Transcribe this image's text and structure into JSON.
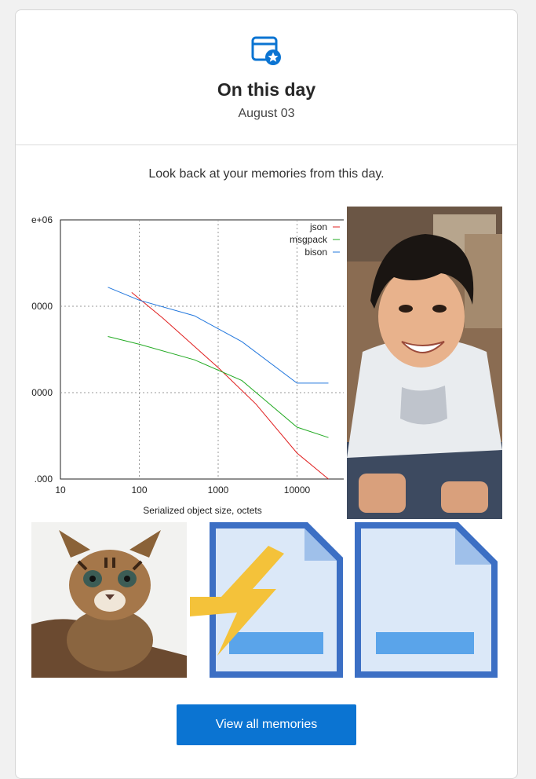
{
  "header": {
    "icon": "calendar-star-icon",
    "accent_color": "#0b74d2",
    "title": "On this day",
    "date": "August 03"
  },
  "intro_text": "Look back at your memories from this day.",
  "memories": [
    {
      "type": "chart",
      "chart_data": {
        "type": "line",
        "xscale": "log",
        "yscale": "log",
        "xlabel": "Serialized object size, octets",
        "x_ticks": [
          "10",
          "100",
          "1000",
          "10000"
        ],
        "y_ticks": [
          ".000",
          "0000",
          "0000",
          "e+06"
        ],
        "grid": true,
        "legend_position": "top-right",
        "series": [
          {
            "name": "json",
            "color": "#e02020",
            "points": [
              [
                80,
                0.72
              ],
              [
                200,
                0.62
              ],
              [
                1000,
                0.43
              ],
              [
                3000,
                0.29
              ],
              [
                10000,
                0.1
              ],
              [
                25000,
                0.0
              ]
            ]
          },
          {
            "name": "msgpack",
            "color": "#22aa22",
            "points": [
              [
                40,
                0.55
              ],
              [
                100,
                0.52
              ],
              [
                500,
                0.46
              ],
              [
                2000,
                0.38
              ],
              [
                10000,
                0.2
              ],
              [
                25000,
                0.16
              ]
            ]
          },
          {
            "name": "bison",
            "color": "#2277dd",
            "points": [
              [
                40,
                0.74
              ],
              [
                100,
                0.69
              ],
              [
                500,
                0.63
              ],
              [
                2000,
                0.53
              ],
              [
                10000,
                0.37
              ],
              [
                25000,
                0.37
              ]
            ]
          }
        ]
      }
    },
    {
      "type": "photo",
      "description": "boy-smiling-photo"
    },
    {
      "type": "photo",
      "description": "leopard-cat-kitten-photo"
    },
    {
      "type": "file",
      "icon": "flash-file-icon"
    },
    {
      "type": "file",
      "icon": "blank-file-icon"
    }
  ],
  "view_all_label": "View all memories"
}
